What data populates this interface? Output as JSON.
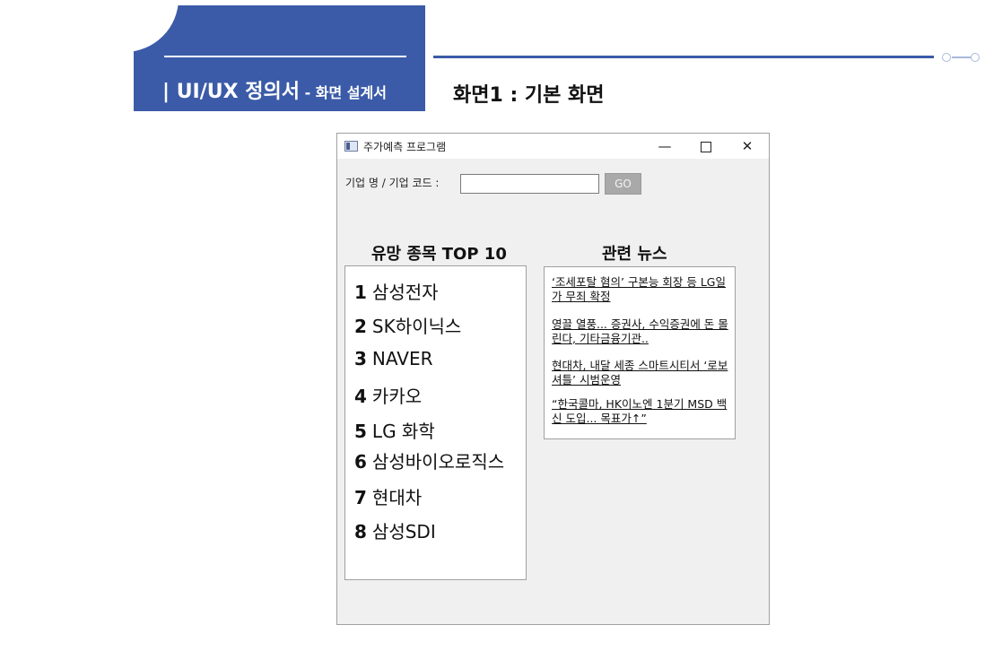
{
  "slide": {
    "header_main": "| UI/UX 정의서",
    "header_sub": " - 화면 설계서",
    "screen_title": "화면1 : 기본 화면"
  },
  "window": {
    "title": "주가예측 프로그램",
    "min_glyph": "—",
    "close_glyph": "✕"
  },
  "search": {
    "label": "기업 명 / 기업 코드 :",
    "value": "",
    "placeholder": "",
    "go_label": "GO"
  },
  "top10": {
    "heading": "유망 종목 TOP 10",
    "items": [
      {
        "rank": "1",
        "name": "삼성전자"
      },
      {
        "rank": "2",
        "name": "SK하이닉스"
      },
      {
        "rank": "3",
        "name": "NAVER"
      },
      {
        "rank": "4",
        "name": "카카오"
      },
      {
        "rank": "5",
        "name": "LG 화학"
      },
      {
        "rank": "6",
        "name": "삼성바이오로직스"
      },
      {
        "rank": "7",
        "name": "현대차"
      },
      {
        "rank": "8",
        "name": "삼성SDI"
      }
    ]
  },
  "news": {
    "heading": "관련 뉴스",
    "items": [
      "‘조세포탈 혐의’ 구본능 회장 등 LG일가 무죄 확정",
      "영끌 열풍... 증권사, 수익증권에 돈 몰린다, 기타금융기관..",
      "현대차, 내달 세종 스마트시티서 ‘로보셔틀’ 시범운영",
      "“한국콜마, HK이노엔 1분기 MSD 백신 도입... 목표가↑”"
    ]
  },
  "colors": {
    "brand_blue": "#3b5ba8",
    "window_bg": "#f0f0f0",
    "go_button": "#a9a9a9"
  }
}
